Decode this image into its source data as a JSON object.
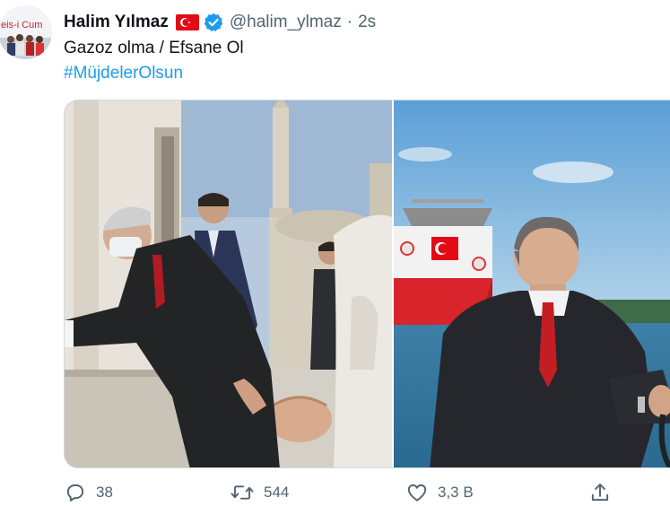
{
  "tweet": {
    "display_name": "Halim Yılmaz",
    "handle": "@halim_ylmaz",
    "separator": "·",
    "timestamp": "2s",
    "text_line1": "Gazoz olma / Efsane Ol",
    "hashtag": "#MüjdelerOlsun",
    "avatar_text": "eis-i Cum",
    "icons": {
      "flag": "turkey-flag-icon",
      "verified": "verified-badge-icon",
      "reply": "reply-icon",
      "retweet": "retweet-icon",
      "like": "heart-icon",
      "share": "share-icon"
    },
    "colors": {
      "accent": "#1d9bf0",
      "muted": "#536471",
      "text": "#0f1419",
      "flag_red": "#e30a17"
    }
  },
  "actions": {
    "reply_count": "38",
    "retweet_count": "544",
    "like_count": "3,3 B"
  }
}
